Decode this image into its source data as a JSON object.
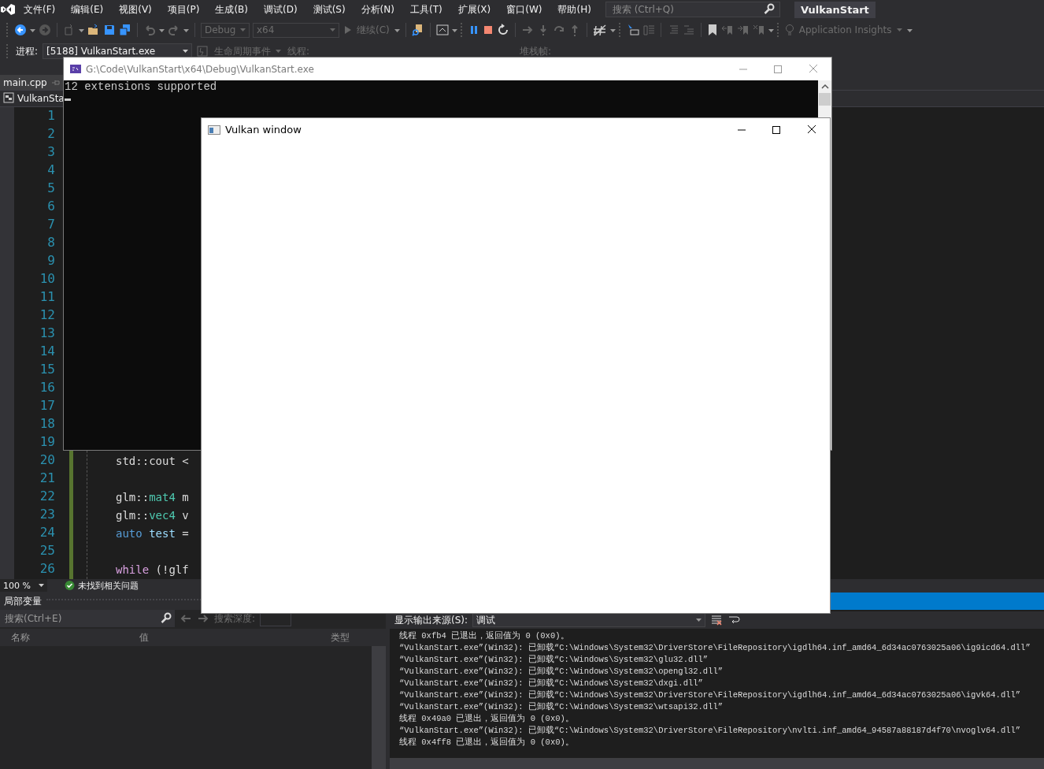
{
  "menu_bar": {
    "items": [
      "文件(F)",
      "编辑(E)",
      "视图(V)",
      "项目(P)",
      "生成(B)",
      "调试(D)",
      "测试(S)",
      "分析(N)",
      "工具(T)",
      "扩展(X)",
      "窗口(W)",
      "帮助(H)"
    ],
    "search": {
      "placeholder": "搜索 (Ctrl+Q)"
    },
    "solution_title": "VulkanStart"
  },
  "toolbar": {
    "configuration": "Debug",
    "platform": "x64",
    "continue": "继续(C)",
    "insights": "Application Insights"
  },
  "debug_location": {
    "process_label": "进程:",
    "process": "[5188] VulkanStart.exe",
    "lifecycle_events": "生命周期事件",
    "thread_label": "线程:",
    "stack_frame_label": "堆栈帧:"
  },
  "editor": {
    "tabs": [
      {
        "label": "main.cpp",
        "selected": true
      }
    ],
    "navigation": "VulkanSta",
    "lines": [
      {
        "number": "1"
      },
      {
        "number": "2"
      },
      {
        "number": "3"
      },
      {
        "number": "4"
      },
      {
        "number": "5"
      },
      {
        "number": "6"
      },
      {
        "number": "7"
      },
      {
        "number": "8"
      },
      {
        "number": "9"
      },
      {
        "number": "10"
      },
      {
        "number": "11"
      },
      {
        "number": "12"
      },
      {
        "number": "13"
      },
      {
        "number": "14"
      },
      {
        "number": "15"
      },
      {
        "number": "16"
      },
      {
        "number": "17"
      },
      {
        "number": "18"
      },
      {
        "number": "19"
      },
      {
        "number": "20",
        "tokens": [
          {
            "text": "std::cout <",
            "kind": "plain"
          }
        ]
      },
      {
        "number": "21"
      },
      {
        "number": "22",
        "tokens": [
          {
            "text": "glm::",
            "kind": "plain"
          },
          {
            "text": "mat4",
            "kind": "type"
          },
          {
            "text": " m",
            "kind": "plain"
          }
        ]
      },
      {
        "number": "23",
        "tokens": [
          {
            "text": "glm::",
            "kind": "plain"
          },
          {
            "text": "vec4",
            "kind": "type"
          },
          {
            "text": " v",
            "kind": "plain"
          }
        ]
      },
      {
        "number": "24",
        "tokens": [
          {
            "text": "auto",
            "kind": "keyword"
          },
          {
            "text": " test",
            "kind": "variable"
          },
          {
            "text": " =",
            "kind": "plain"
          }
        ]
      },
      {
        "number": "25"
      },
      {
        "number": "26",
        "tokens": [
          {
            "text": "while",
            "kind": "control"
          },
          {
            "text": " (!glf",
            "kind": "plain"
          }
        ]
      }
    ],
    "zoom": "100 %",
    "issues": "未找到相关问题"
  },
  "locals": {
    "title": "局部变量",
    "search": {
      "placeholder": "搜索(Ctrl+E)"
    },
    "depth_label": "搜索深度:",
    "columns": [
      "名称",
      "值",
      "类型"
    ]
  },
  "output": {
    "source_label": "显示输出来源(S):",
    "source": "调试",
    "lines": [
      "线程 0xfb4 已退出，返回值为 0 (0x0)。",
      "“VulkanStart.exe”(Win32): 已卸载“C:\\Windows\\System32\\DriverStore\\FileRepository\\igdlh64.inf_amd64_6d34ac0763025a06\\ig9icd64.dll”",
      "“VulkanStart.exe”(Win32): 已卸载“C:\\Windows\\System32\\glu32.dll”",
      "“VulkanStart.exe”(Win32): 已卸载“C:\\Windows\\System32\\opengl32.dll”",
      "“VulkanStart.exe”(Win32): 已卸载“C:\\Windows\\System32\\dxgi.dll”",
      "“VulkanStart.exe”(Win32): 已卸载“C:\\Windows\\System32\\DriverStore\\FileRepository\\igdlh64.inf_amd64_6d34ac0763025a06\\igvk64.dll”",
      "“VulkanStart.exe”(Win32): 已卸载“C:\\Windows\\System32\\wtsapi32.dll”",
      "线程 0x49a0 已退出，返回值为 0 (0x0)。",
      "“VulkanStart.exe”(Win32): 已卸载“C:\\Windows\\System32\\DriverStore\\FileRepository\\nvlti.inf_amd64_94587a88187d4f70\\nvoglv64.dll”",
      "线程 0x4ff8 已退出，返回值为 0 (0x0)。"
    ]
  },
  "console_window": {
    "title": "G:\\Code\\VulkanStart\\x64\\Debug\\VulkanStart.exe",
    "lines": [
      "12 extensions supported"
    ]
  },
  "vulkan_window": {
    "title": "Vulkan window"
  }
}
